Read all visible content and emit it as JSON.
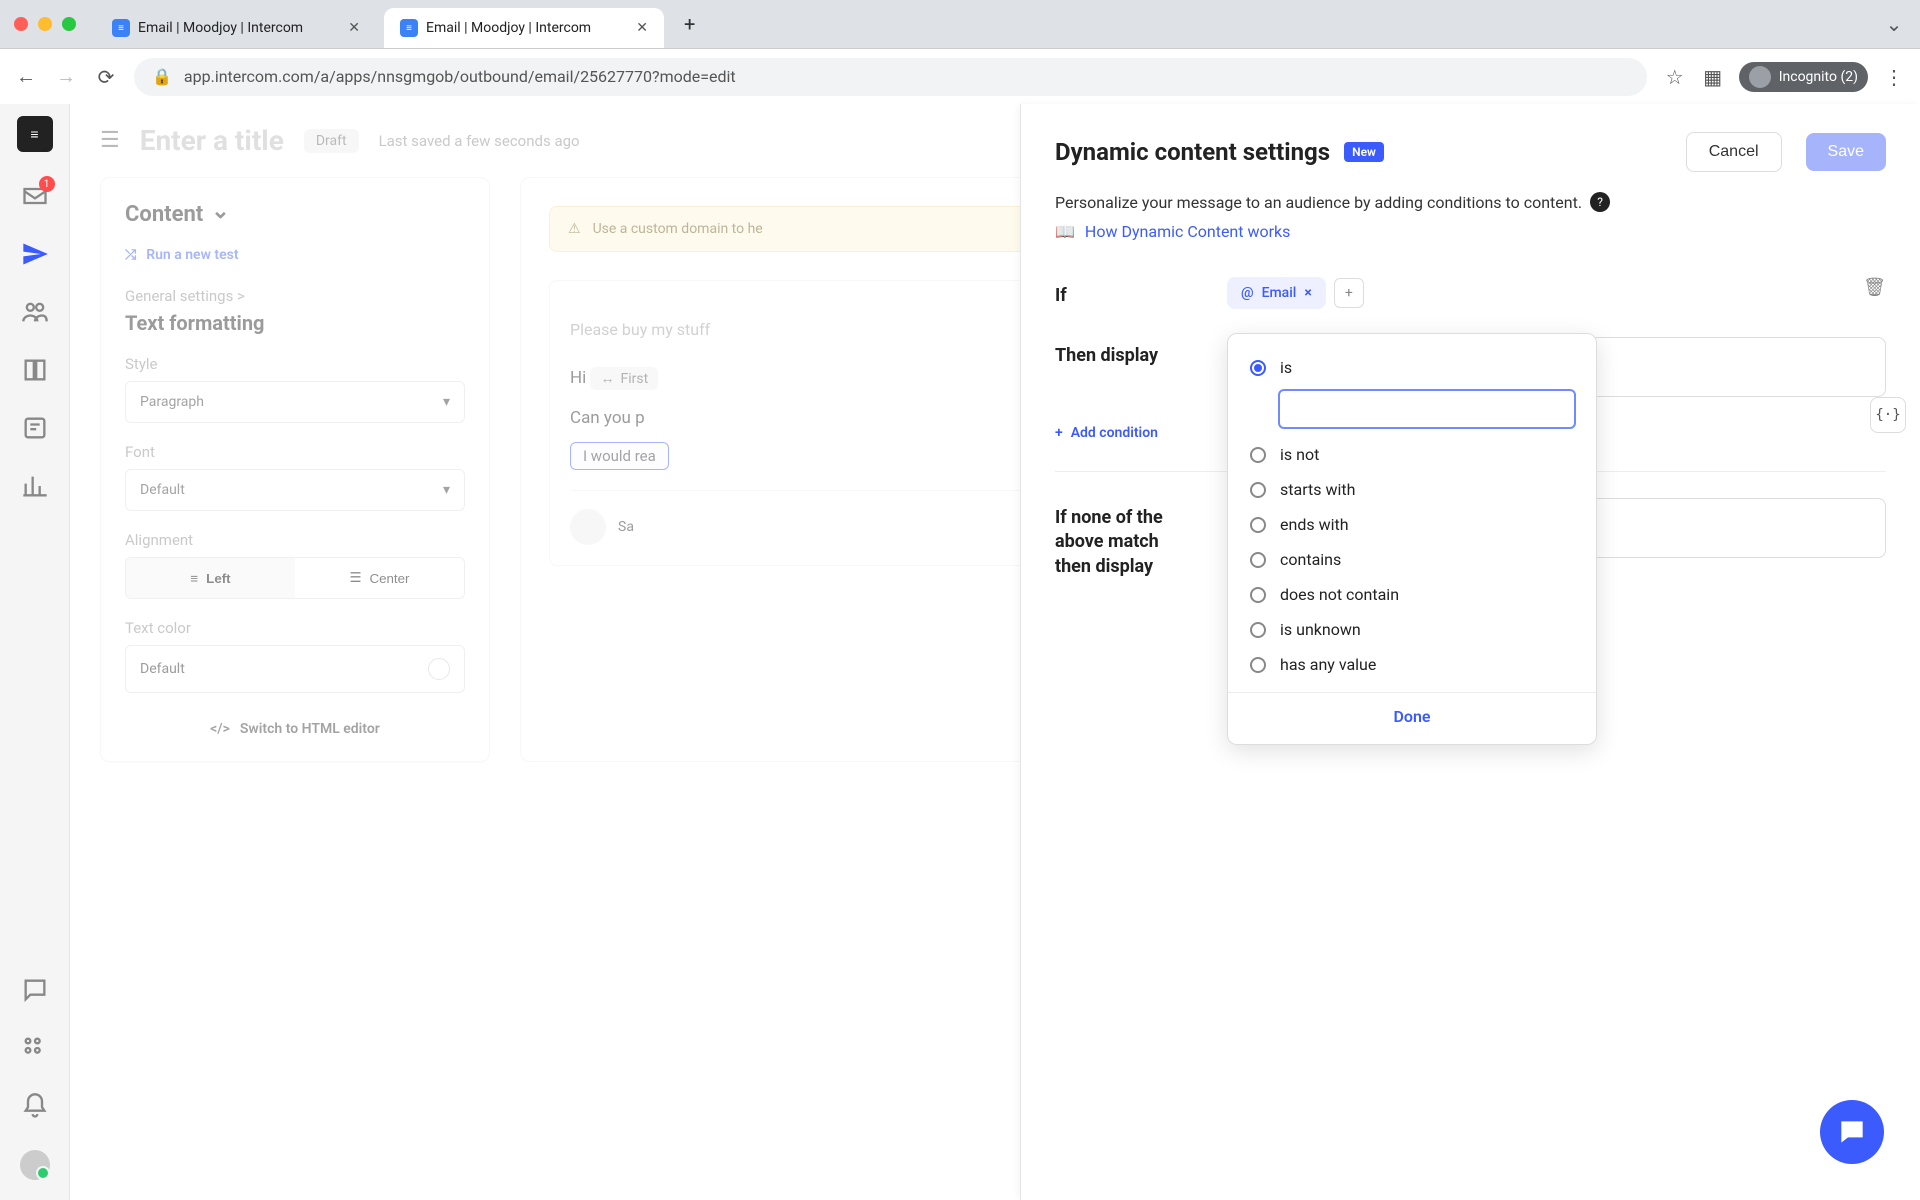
{
  "browser": {
    "tabs": [
      {
        "title": "Email | Moodjoy | Intercom",
        "active": false
      },
      {
        "title": "Email | Moodjoy | Intercom",
        "active": true
      }
    ],
    "url": "app.intercom.com/a/apps/nnsgmgob/outbound/email/25627770?mode=edit",
    "incognito_label": "Incognito (2)"
  },
  "rail": {
    "inbox_badge": "1"
  },
  "page": {
    "title_placeholder": "Enter a title",
    "status": "Draft",
    "last_saved": "Last saved a few seconds ago"
  },
  "sidepanel": {
    "heading": "Content",
    "run_test": "Run a new test",
    "breadcrumb": "General settings >",
    "section": "Text formatting",
    "style_label": "Style",
    "style_value": "Paragraph",
    "font_label": "Font",
    "font_value": "Default",
    "align_label": "Alignment",
    "align_left": "Left",
    "align_center": "Center",
    "color_label": "Text color",
    "color_value": "Default",
    "switch_html": "Switch to HTML editor"
  },
  "email": {
    "warning": "Use a custom domain to he",
    "subject_placeholder": "Please buy my stuff",
    "greeting_prefix": "Hi",
    "first_name_token": "First",
    "line2_prefix": "Can you p",
    "dynamic_chip": "I would rea",
    "sender_prefix": "Sa"
  },
  "panel": {
    "title": "Dynamic content settings",
    "new_badge": "New",
    "cancel": "Cancel",
    "save": "Save",
    "description": "Personalize your message to an audience by adding conditions to content.",
    "learn_link": "How Dynamic Content works",
    "if_label": "If",
    "tag_label": "Email",
    "then_label": "Then display",
    "add_condition": "Add condition",
    "fallback_label": "If none of the above match then display"
  },
  "popover": {
    "options": [
      "is",
      "is not",
      "starts with",
      "ends with",
      "contains",
      "does not contain",
      "is unknown",
      "has any value"
    ],
    "selected_index": 0,
    "input_value": "",
    "done": "Done"
  }
}
